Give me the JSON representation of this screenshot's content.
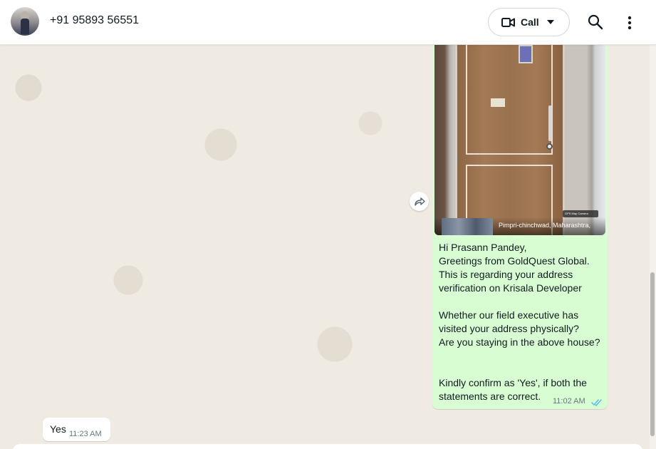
{
  "header": {
    "contact_name": "+91 95893 56551",
    "call_label": "Call",
    "icons": {
      "video": "video-camera-icon",
      "caret": "caret-down-icon",
      "search": "search-icon",
      "menu": "more-vertical-icon"
    }
  },
  "messages": [
    {
      "direction": "outgoing",
      "image_caption_stamp": "Pimpri-chinchwad, Maharashtra,",
      "image_brand_stamp": "GPS Map Camera",
      "text": "Hi Prasann Pandey,\nGreetings from GoldQuest Global.\nThis is regarding your address verification on Krisala Developer\n\nWhether our field executive has visited your address physically?\nAre you staying in the above house?\n\n\nKindly confirm as 'Yes', if both the statements are correct.",
      "time": "11:02 AM",
      "status": "read"
    },
    {
      "direction": "incoming",
      "text": "Yes",
      "time": "11:23 AM"
    }
  ],
  "colors": {
    "outgoing_bubble": "#d9fdd3",
    "incoming_bubble": "#ffffff",
    "chat_background": "#efeae2",
    "read_ticks": "#53bdeb"
  }
}
